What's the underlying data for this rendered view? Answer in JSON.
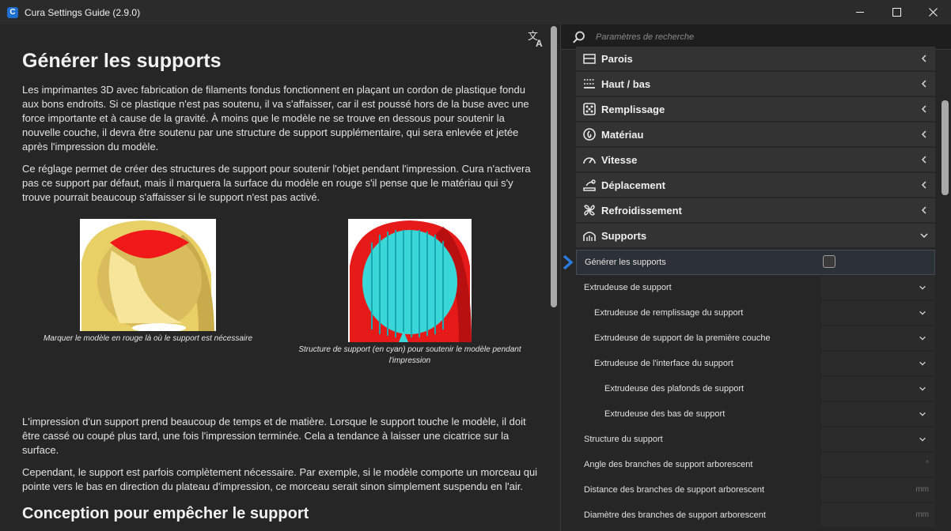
{
  "window": {
    "title": "Cura Settings Guide (2.9.0)",
    "app_icon_letter": "C",
    "minimize_icon": "minimize-icon",
    "maximize_icon": "maximize-icon",
    "close_icon": "close-icon"
  },
  "article": {
    "translate_icon": "translate-icon",
    "title": "Générer les supports",
    "paragraphs": [
      "Les imprimantes 3D avec fabrication de filaments fondus fonctionnent en plaçant un cordon de plastique fondu aux bons endroits. Si ce plastique n'est pas soutenu, il va s'affaisser, car il est poussé hors de la buse avec une force importante et à cause de la gravité. À moins que le modèle ne se trouve en dessous pour soutenir la nouvelle couche, il devra être soutenu par une structure de support supplémentaire, qui sera enlevée et jetée après l'impression du modèle.",
      "Ce réglage permet de créer des structures de support pour soutenir l'objet pendant l'impression. Cura n'activera pas ce support par défaut, mais il marquera la surface du modèle en rouge s'il pense que le matériau qui s'y trouve pourrait beaucoup s'affaisser si le support n'est pas activé."
    ],
    "figures": [
      {
        "caption": "Marquer le modèle en rouge là où le support est nécessaire"
      },
      {
        "caption": "Structure de support (en cyan) pour soutenir le modèle pendant l'impression"
      }
    ],
    "paragraphs_after": [
      "L'impression d'un support prend beaucoup de temps et de matière. Lorsque le support touche le modèle, il doit être cassé ou coupé plus tard, une fois l'impression terminée. Cela a tendance à laisser une cicatrice sur la surface.",
      "Cependant, le support est parfois complètement nécessaire. Par exemple, si le modèle comporte un morceau qui pointe vers le bas en direction du plateau d'impression, ce morceau serait sinon simplement suspendu en l'air."
    ],
    "subtitle": "Conception pour empêcher le support"
  },
  "panel": {
    "search_placeholder": "Paramètres de recherche",
    "categories": [
      {
        "label": "Parois",
        "icon": "walls-icon",
        "expanded": false
      },
      {
        "label": "Haut / bas",
        "icon": "top-bottom-icon",
        "expanded": false
      },
      {
        "label": "Remplissage",
        "icon": "infill-icon",
        "expanded": false
      },
      {
        "label": "Matériau",
        "icon": "material-icon",
        "expanded": false
      },
      {
        "label": "Vitesse",
        "icon": "speed-icon",
        "expanded": false
      },
      {
        "label": "Déplacement",
        "icon": "travel-icon",
        "expanded": false
      },
      {
        "label": "Refroidissement",
        "icon": "cooling-fan-icon",
        "expanded": false
      },
      {
        "label": "Supports",
        "icon": "support-icon",
        "expanded": true
      }
    ],
    "settings": [
      {
        "label": "Générer les supports",
        "control": "checkbox",
        "checked": false,
        "active": true,
        "indent": 0
      },
      {
        "label": "Extrudeuse de support",
        "control": "dropdown",
        "indent": 0
      },
      {
        "label": "Extrudeuse de remplissage du support",
        "control": "dropdown",
        "indent": 1
      },
      {
        "label": "Extrudeuse de support de la première couche",
        "control": "dropdown",
        "indent": 1
      },
      {
        "label": "Extrudeuse de l'interface du support",
        "control": "dropdown",
        "indent": 1
      },
      {
        "label": "Extrudeuse des plafonds de support",
        "control": "dropdown",
        "indent": 2
      },
      {
        "label": "Extrudeuse des bas de support",
        "control": "dropdown",
        "indent": 2
      },
      {
        "label": "Structure du support",
        "control": "dropdown",
        "indent": 0
      },
      {
        "label": "Angle des branches de support arborescent",
        "control": "number",
        "unit": "°",
        "indent": 0
      },
      {
        "label": "Distance des branches de support arborescent",
        "control": "number",
        "unit": "mm",
        "indent": 0
      },
      {
        "label": "Diamètre des branches de support arborescent",
        "control": "number",
        "unit": "mm",
        "indent": 0
      }
    ]
  }
}
